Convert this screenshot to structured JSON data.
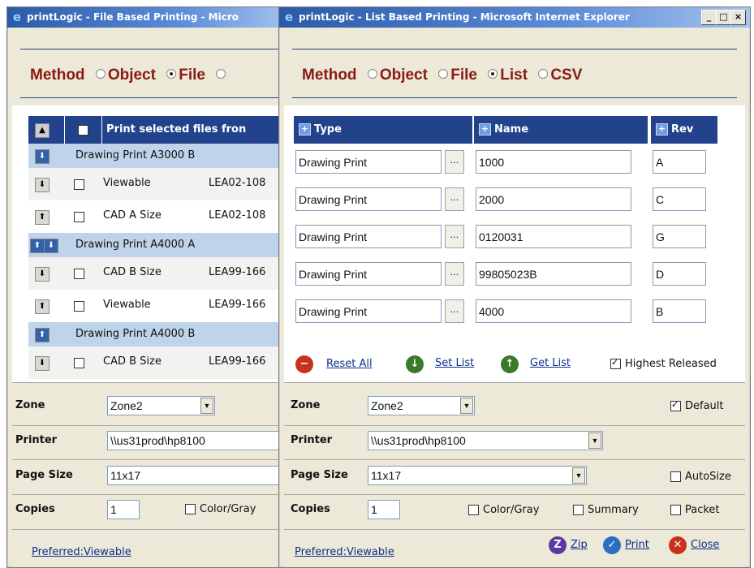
{
  "back_window": {
    "title": "printLogic - File Based Printing - Micro",
    "method": {
      "label": "Method",
      "options": [
        "Object",
        "File",
        ""
      ],
      "selected": 1
    },
    "header": {
      "text": "Print selected files fron"
    },
    "groups": [
      {
        "title": "Drawing Print  A3000  B",
        "items": [
          {
            "kind": "down",
            "name": "Viewable",
            "file": "LEA02-108"
          },
          {
            "kind": "up",
            "name": "CAD A Size",
            "file": "LEA02-108"
          }
        ]
      },
      {
        "title": "Drawing Print  A4000  A",
        "items": [
          {
            "kind": "down",
            "name": "CAD B Size",
            "file": "LEA99-166"
          },
          {
            "kind": "up",
            "name": "Viewable",
            "file": "LEA99-166"
          }
        ]
      },
      {
        "title": "Drawing Print  A4000  B",
        "items": [
          {
            "kind": "down",
            "name": "CAD B Size",
            "file": "LEA99-166"
          }
        ]
      }
    ],
    "zone": {
      "label": "Zone",
      "value": "Zone2"
    },
    "printer": {
      "label": "Printer",
      "value": "\\\\us31prod\\hp8100"
    },
    "page_size": {
      "label": "Page Size",
      "value": "11x17"
    },
    "copies": {
      "label": "Copies",
      "value": "1"
    },
    "color_gray": "Color/Gray",
    "preferred": "Preferred:Viewable"
  },
  "front_window": {
    "title": "printLogic - List Based Printing - Microsoft Internet Explorer",
    "method": {
      "label": "Method",
      "options": [
        "Object",
        "File",
        "List",
        "CSV"
      ],
      "selected": 2
    },
    "columns": {
      "type": "Type",
      "name": "Name",
      "rev": "Rev"
    },
    "rows": [
      {
        "type": "Drawing Print",
        "name": "1000",
        "rev": "A"
      },
      {
        "type": "Drawing Print",
        "name": "2000",
        "rev": "C"
      },
      {
        "type": "Drawing Print",
        "name": "0120031",
        "rev": "G"
      },
      {
        "type": "Drawing Print",
        "name": "99805023B",
        "rev": "D"
      },
      {
        "type": "Drawing Print",
        "name": "4000",
        "rev": "B"
      }
    ],
    "actions": {
      "reset": "Reset All",
      "set": "Set List",
      "get": "Get List",
      "highest": "Highest Released"
    },
    "zone": {
      "label": "Zone",
      "value": "Zone2"
    },
    "default": "Default",
    "printer": {
      "label": "Printer",
      "value": "\\\\us31prod\\hp8100"
    },
    "page_size": {
      "label": "Page Size",
      "value": "11x17"
    },
    "autosize": "AutoSize",
    "copies": {
      "label": "Copies",
      "value": "1"
    },
    "color_gray": "Color/Gray",
    "summary": "Summary",
    "packet": "Packet",
    "preferred": "Preferred:Viewable",
    "footer": {
      "zip": "Zip",
      "print": "Print",
      "close": "Close"
    },
    "checked": {
      "highest": true,
      "default": true,
      "autosize": false,
      "color_gray": false,
      "summary": false,
      "packet": false
    }
  }
}
